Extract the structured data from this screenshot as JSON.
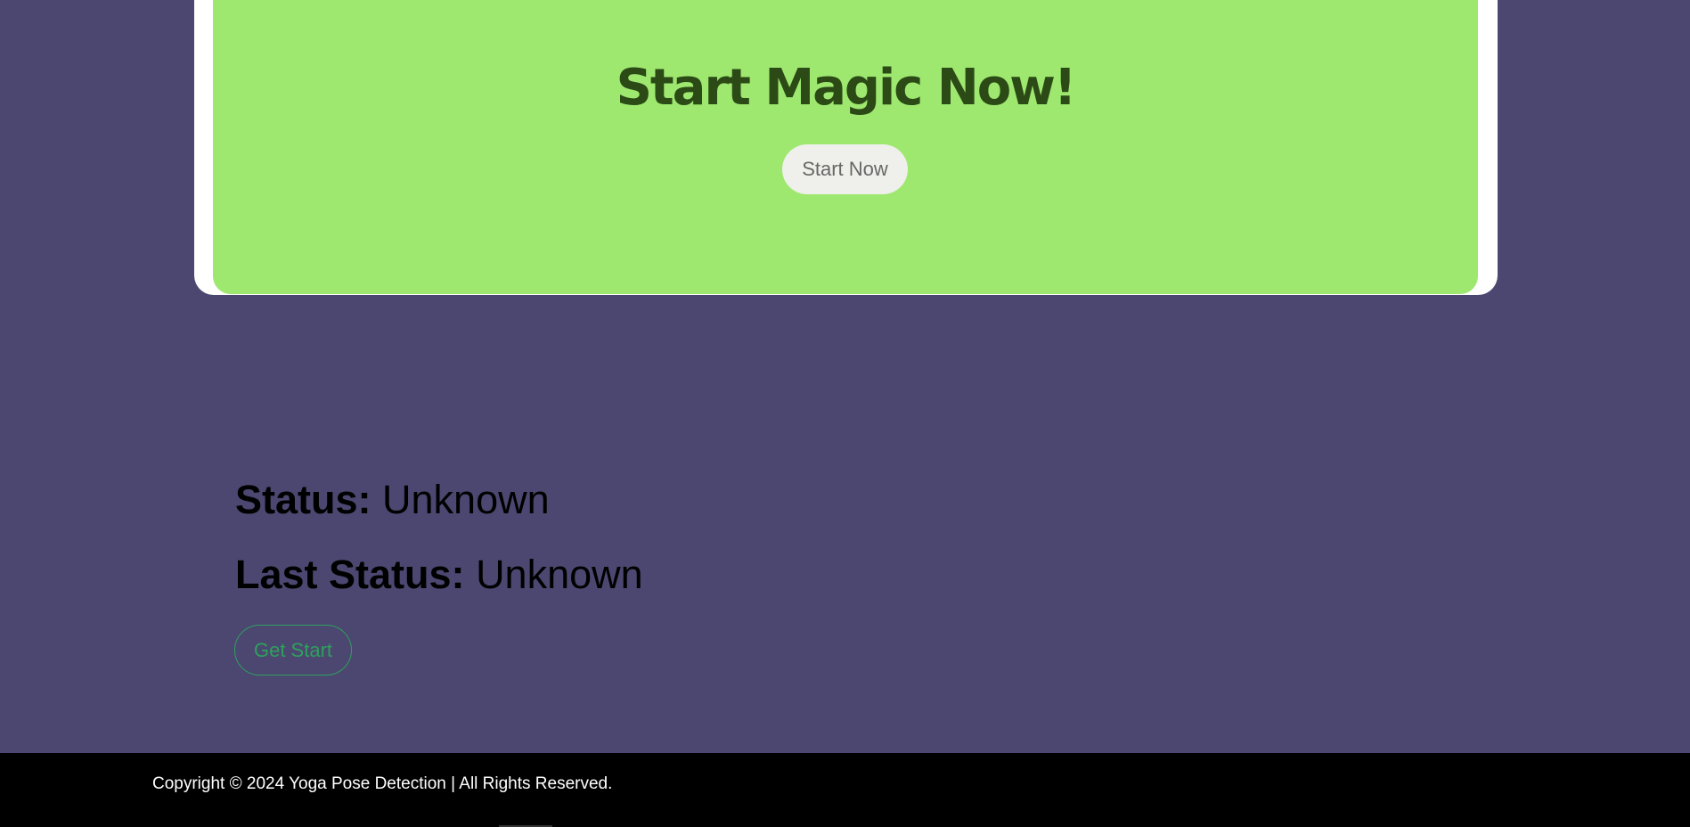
{
  "hero": {
    "title": "Start Magic Now!",
    "button_label": "Start Now"
  },
  "status": {
    "status_label": "Status:",
    "status_value": "Unknown",
    "last_status_label": "Last Status:",
    "last_status_value": "Unknown",
    "get_start_label": "Get Start"
  },
  "footer": {
    "copyright": "Copyright © 2024 Yoga Pose Detection | All Rights Reserved."
  },
  "colors": {
    "page_background": "#4b4770",
    "hero_background": "#9fe870",
    "hero_title": "#2b4a16",
    "accent_green": "#2fa05c",
    "footer_background": "#000000"
  }
}
